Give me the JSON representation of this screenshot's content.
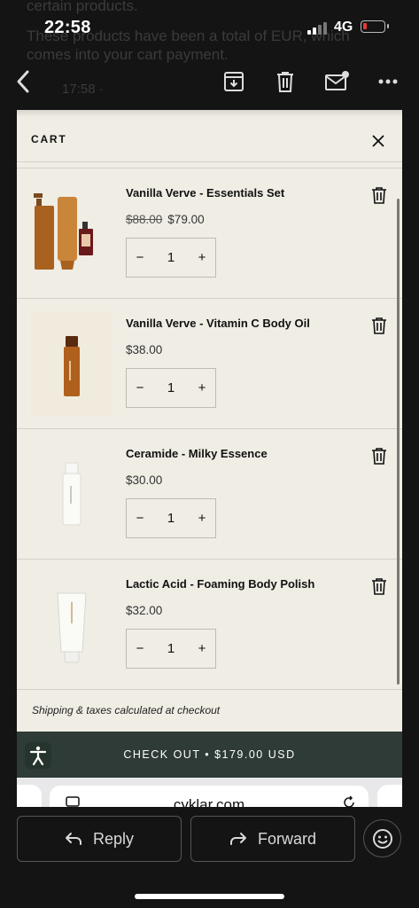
{
  "status_bar": {
    "time": "22:58",
    "network": "4G"
  },
  "background_email": {
    "lines": [
      "certain products.",
      "These products have been a total of EUR, which",
      "comes into your cart payment."
    ],
    "toolbar_text": "17:58 ·"
  },
  "mail_toolbar": {
    "back_icon": "chevron-left-icon",
    "archive_icon": "archive-icon",
    "delete_icon": "trash-icon",
    "unread_icon": "mail-unread-icon",
    "more_icon": "more-icon"
  },
  "cart": {
    "title": "CART",
    "items": [
      {
        "name": "Vanilla Verve - Essentials Set",
        "price_old": "$88.00",
        "price": "$79.00",
        "quantity": "1"
      },
      {
        "name": "Vanilla Verve - Vitamin C Body Oil",
        "price_old": "",
        "price": "$38.00",
        "quantity": "1"
      },
      {
        "name": "Ceramide - Milky Essence",
        "price_old": "",
        "price": "$30.00",
        "quantity": "1"
      },
      {
        "name": "Lactic Acid - Foaming Body Polish",
        "price_old": "",
        "price": "$32.00",
        "quantity": "1"
      }
    ],
    "qty_minus": "−",
    "qty_plus": "+",
    "note": "Shipping & taxes calculated at checkout",
    "checkout_label": "CHECK OUT • $179.00 USD"
  },
  "browser": {
    "url": "cyklar.com"
  },
  "actions": {
    "reply": "Reply",
    "forward": "Forward"
  },
  "colors": {
    "cart_bg": "#efede4",
    "checkout_bg": "#2e3b36",
    "page_bg": "#141414"
  }
}
